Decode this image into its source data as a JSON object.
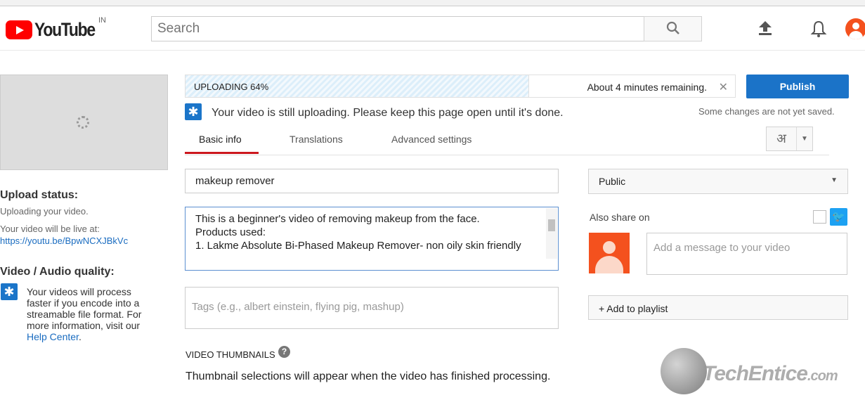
{
  "header": {
    "logo": "YouTube",
    "region": "IN",
    "search_placeholder": "Search",
    "icons": [
      "search-icon",
      "upload-icon",
      "bell-icon",
      "avatar"
    ]
  },
  "sidebar": {
    "upload_status_title": "Upload status:",
    "upload_status_text": "Uploading your video.",
    "live_at_label": "Your video will be live at:",
    "live_url": "https://youtu.be/BpwNCXJBkVc",
    "quality_title": "Video / Audio quality:",
    "quality_text": "Your videos will process faster if you encode into a streamable file format. For more information, visit our",
    "help_link": "Help Center",
    "help_suffix": "."
  },
  "upload": {
    "status_label": "UPLOADING 64%",
    "progress_percent": 64,
    "remaining": "About 4 minutes remaining.",
    "notice": "Your video is still uploading. Please keep this page open until it's done.",
    "unsaved": "Some changes are not yet saved.",
    "publish_label": "Publish"
  },
  "tabs": [
    {
      "label": "Basic info",
      "active": true
    },
    {
      "label": "Translations"
    },
    {
      "label": "Advanced settings"
    }
  ],
  "language_button": "अ",
  "form": {
    "title_value": "makeup remover",
    "description_value": "This is a beginner's video of removing makeup from the face.\nProducts used:\n1. Lakme Absolute Bi-Phased Makeup Remover- non oily skin friendly",
    "tags_placeholder": "Tags (e.g., albert einstein, flying pig, mashup)",
    "thumbnails_title": "VIDEO THUMBNAILS",
    "thumbnails_text": "Thumbnail selections will appear when the video has finished processing."
  },
  "right": {
    "privacy_value": "Public",
    "also_share": "Also share on",
    "message_placeholder": "Add a message to your video",
    "playlist_label": "+ Add to playlist"
  },
  "colors": {
    "accent": "#1b73c8",
    "tab_active": "#cc181e",
    "brand_red": "#ff0000"
  },
  "watermark": "eTechEntice.com"
}
